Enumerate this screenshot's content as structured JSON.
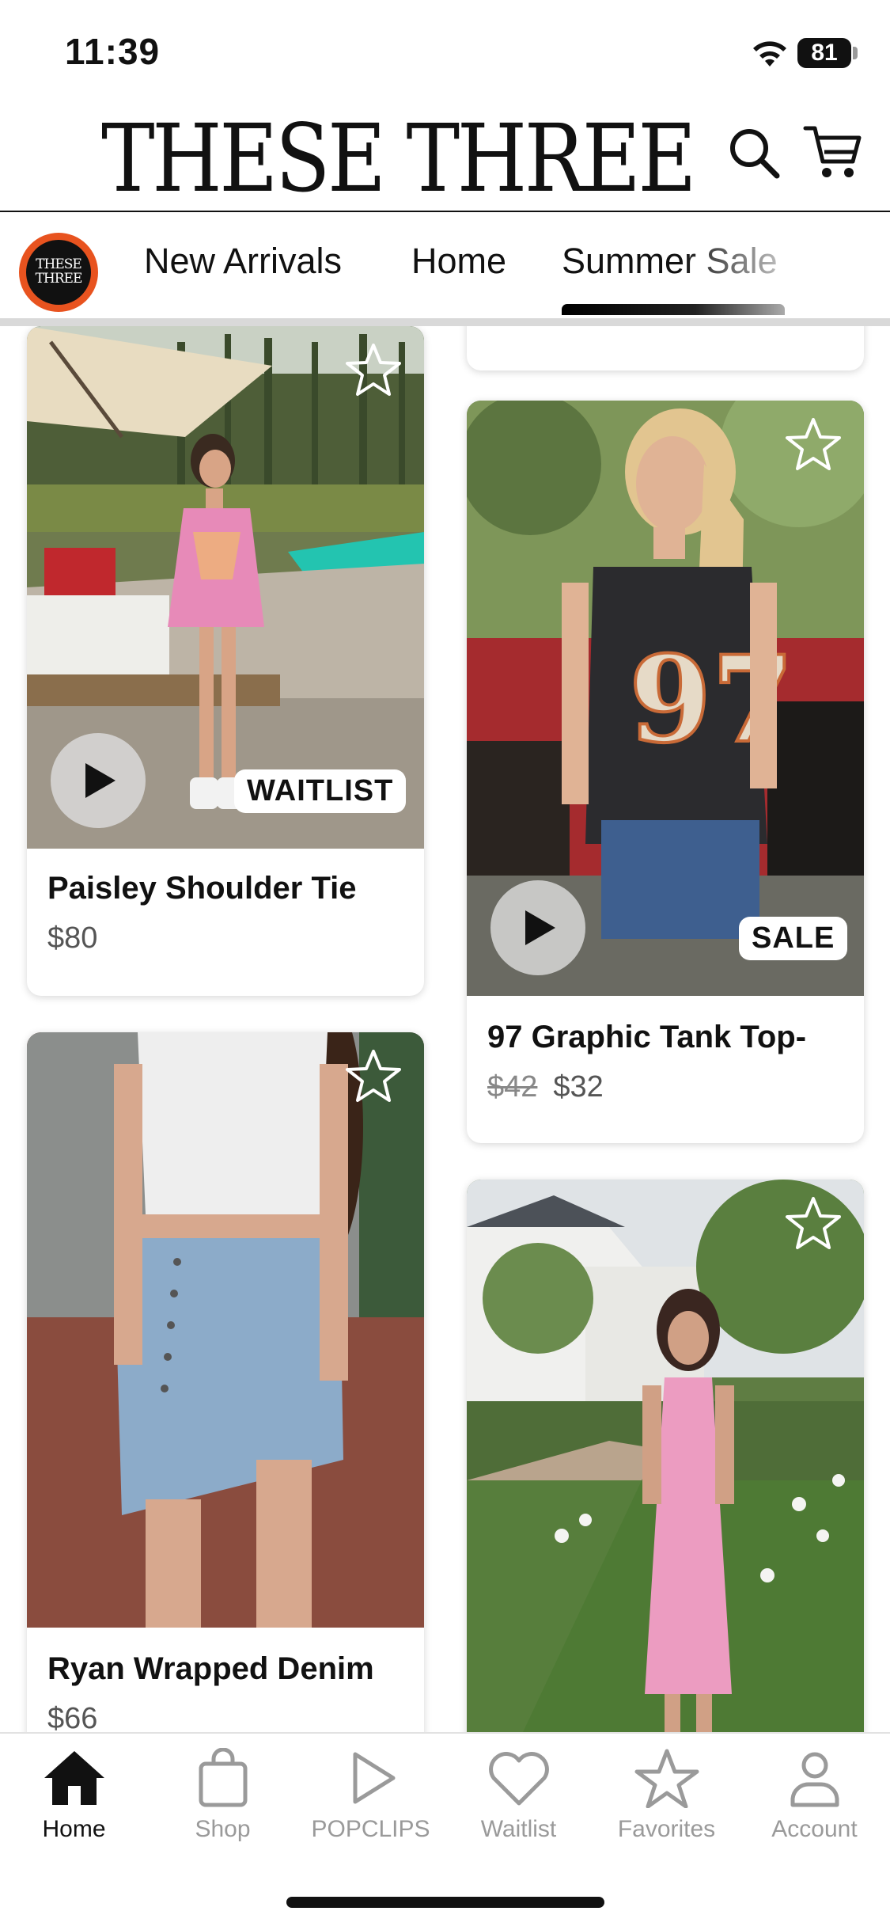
{
  "status": {
    "time": "11:39",
    "battery": "81"
  },
  "header": {
    "brand": "THESE THREE",
    "mini_logo": "THESE THREE"
  },
  "categories": [
    {
      "label": "New Arrivals"
    },
    {
      "label": "Home"
    },
    {
      "label": "Summer Sale",
      "selected": true
    }
  ],
  "products": [
    {
      "title": "Paisley Shoulder Tie",
      "price": "$80",
      "badge": "WAITLIST",
      "has_video": true
    },
    {
      "title": "97 Graphic Tank Top-",
      "original_price": "$42",
      "price": "$32",
      "badge": "SALE",
      "has_video": true
    },
    {
      "title": "Ryan Wrapped Denim",
      "price": "$66"
    },
    {
      "title": "",
      "price": ""
    }
  ],
  "tabs": [
    {
      "label": "Home",
      "icon": "home-icon",
      "active": true
    },
    {
      "label": "Shop",
      "icon": "shopping-bag-icon"
    },
    {
      "label": "POPCLIPS",
      "icon": "play-icon"
    },
    {
      "label": "Waitlist",
      "icon": "heart-icon"
    },
    {
      "label": "Favorites",
      "icon": "star-icon"
    },
    {
      "label": "Account",
      "icon": "user-icon"
    }
  ],
  "colors": {
    "accent": "#111111",
    "logo_ring": "#e8531f",
    "inactive": "#9a9a9a"
  }
}
